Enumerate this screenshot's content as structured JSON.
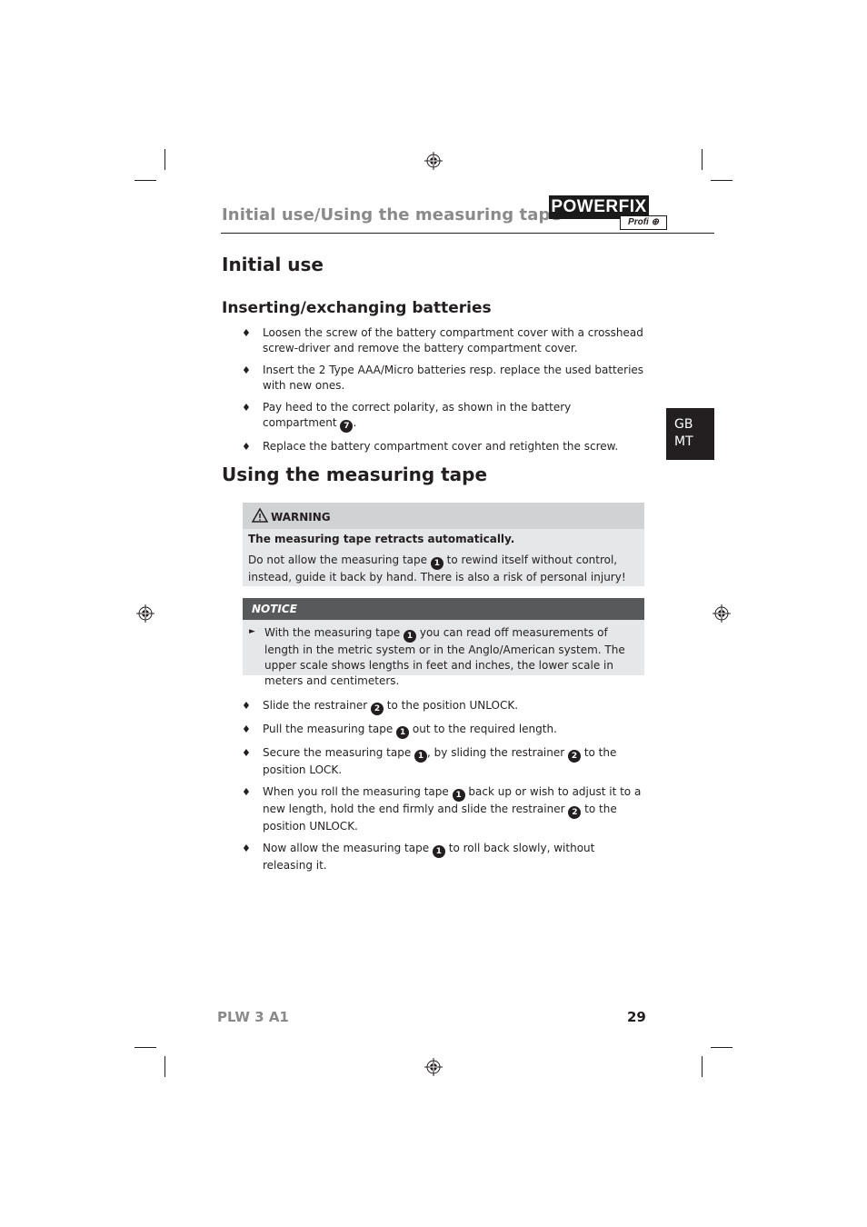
{
  "header": {
    "section_title": "Initial use/Using the measuring tape",
    "logo_brand": "POWERFIX",
    "logo_sub": "Profi ⊕"
  },
  "initial_use": {
    "heading": "Initial use",
    "subheading": "Inserting/exchanging batteries",
    "items": [
      {
        "text": "Loosen the screw of the battery compartment cover with a crosshead screw-driver and remove the battery compartment cover."
      },
      {
        "text": "Insert the 2 Type AAA/Micro batteries resp. replace the used batteries with new ones."
      },
      {
        "text_before": "Pay heed to the correct polarity, as shown in the battery compartment ",
        "ref": "7",
        "text_after": "."
      },
      {
        "text": "Replace the battery compartment cover and retighten the screw."
      }
    ]
  },
  "using": {
    "heading": "Using the measuring tape",
    "warning": {
      "title": "WARNING",
      "subtitle": "The measuring tape retracts automatically.",
      "body_before": " Do not allow the measuring tape ",
      "ref": "1",
      "body_after": " to rewind itself without control, instead, guide it back by hand. There is also a risk of personal injury!"
    },
    "notice": {
      "title": "NOTICE",
      "body_before": "With the measuring tape ",
      "ref": "1",
      "body_after": " you can read off measurements of length in the metric system or in the Anglo/American system. The upper scale shows lengths in feet and inches, the lower scale in meters and centimeters."
    },
    "steps": [
      {
        "a": "Slide the restrainer ",
        "r1": "2",
        "b": " to the position UNLOCK."
      },
      {
        "a": "Pull the measuring tape ",
        "r1": "1",
        "b": " out to the required length."
      },
      {
        "a": "Secure the measuring tape ",
        "r1": "1",
        "b": ", by sliding the restrainer ",
        "r2": "2",
        "c": " to the position LOCK."
      },
      {
        "a": "When you roll the measuring tape ",
        "r1": "1",
        "b": " back up or wish to adjust it to a new length, hold the end firmly and slide the restrainer ",
        "r2": "2",
        "c": " to the position UNLOCK."
      },
      {
        "a": "Now allow the measuring tape ",
        "r1": "1",
        "b": " to roll back slowly, without releasing it."
      }
    ]
  },
  "language_tab": {
    "line1": "GB",
    "line2": "MT"
  },
  "footer": {
    "model": "PLW 3 A1",
    "page": "29"
  },
  "icons": {
    "bullet": "♦",
    "arrow": "►"
  }
}
